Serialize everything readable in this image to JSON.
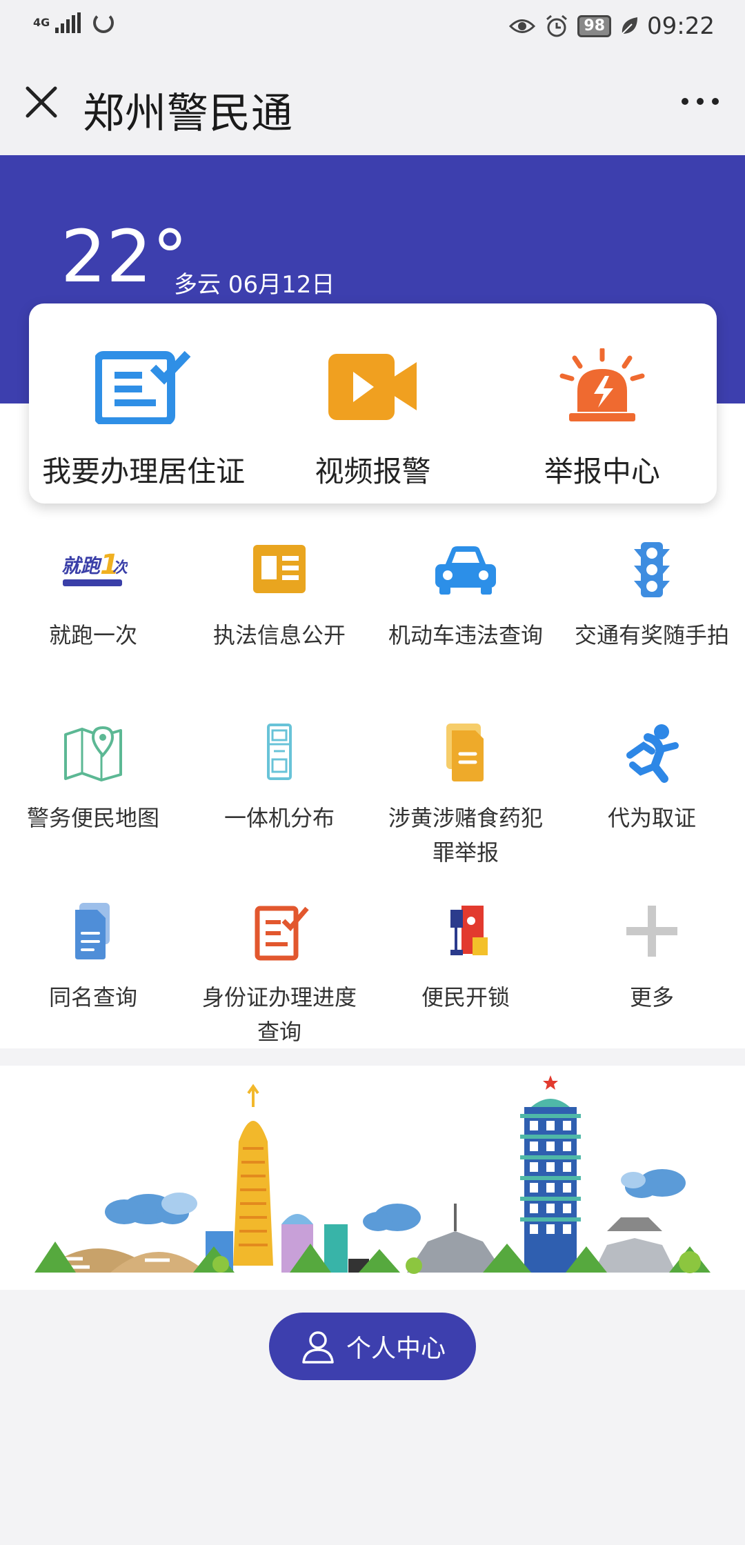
{
  "status_bar": {
    "network": "4G",
    "battery": "98",
    "time": "09:22",
    "icons": [
      "eye-icon",
      "alarm-icon",
      "leaf-icon"
    ]
  },
  "header": {
    "title": "郑州警民通",
    "close_icon": "close-icon",
    "more_icon": "more-icon"
  },
  "weather": {
    "temperature": "22°",
    "description": "多云 06月12日"
  },
  "main_actions": [
    {
      "label": "我要办理居住证",
      "icon": "form-check-icon",
      "color": "#2f8fe6"
    },
    {
      "label": "视频报警",
      "icon": "video-camera-icon",
      "color": "#f0a020"
    },
    {
      "label": "举报中心",
      "icon": "alarm-light-icon",
      "color": "#ef6a30"
    }
  ],
  "services": [
    {
      "label": "就跑一次",
      "icon": "run-once-logo-icon"
    },
    {
      "label": "执法信息公开",
      "icon": "info-card-icon",
      "color": "#e9a51f"
    },
    {
      "label": "机动车违法查询",
      "icon": "car-icon",
      "color": "#2c8fe8"
    },
    {
      "label": "交通有奖随手拍",
      "icon": "traffic-light-icon",
      "color": "#3e8de0"
    },
    {
      "label": "警务便民地图",
      "icon": "map-pin-icon",
      "color": "#5cb894"
    },
    {
      "label": "一体机分布",
      "icon": "kiosk-icon",
      "color": "#68c3d8"
    },
    {
      "label": "涉黄涉赌食药犯罪举报",
      "icon": "document-icon",
      "color": "#eeaa2a"
    },
    {
      "label": "代为取证",
      "icon": "running-person-icon",
      "color": "#2d87e6"
    },
    {
      "label": "同名查询",
      "icon": "files-icon",
      "color": "#4f8ed8"
    },
    {
      "label": "身份证办理进度查询",
      "icon": "edit-form-icon",
      "color": "#e2572e"
    },
    {
      "label": "便民开锁",
      "icon": "lock-logo-icon"
    },
    {
      "label": "更多",
      "icon": "plus-icon",
      "color": "#c9c9c9"
    }
  ],
  "personal_center": {
    "label": "个人中心",
    "icon": "person-icon"
  },
  "colors": {
    "primary": "#3d3fae",
    "background": "#f3f3f5"
  }
}
